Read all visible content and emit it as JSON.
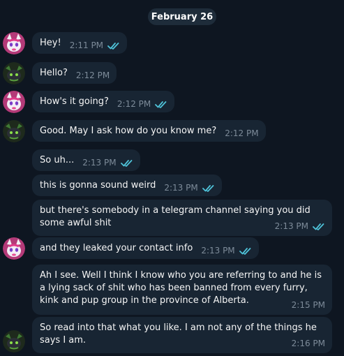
{
  "date": "February 26",
  "colors": {
    "background": "#0e1621",
    "bubble": "#182533",
    "check": "#4fc3d9",
    "time": "#7d8b99"
  },
  "avatars": {
    "user_a": "pink-furry-avatar",
    "user_b": "dark-dragon-avatar"
  },
  "messages": [
    {
      "text": "Hey!",
      "time": "2:11 PM",
      "read": true
    },
    {
      "text": "Hello?",
      "time": "2:12 PM",
      "read": false
    },
    {
      "text": "How's it going?",
      "time": "2:12 PM",
      "read": true
    },
    {
      "text": "Good. May I ask how do you know me?",
      "time": "2:12 PM",
      "read": false
    },
    {
      "text": "So uh...",
      "time": "2:13 PM",
      "read": true
    },
    {
      "text": "this is  gonna sound weird",
      "time": "2:13 PM",
      "read": true
    },
    {
      "text": "but there's somebody in a telegram channel saying you did some awful shit",
      "time": "2:13 PM",
      "read": true
    },
    {
      "text": "and they leaked your contact info",
      "time": "2:13 PM",
      "read": true
    },
    {
      "text": "Ah I see. Well I think I know who you are referring to and he is a lying sack of shit who has been banned from every furry, kink and pup group in the province of Alberta.",
      "time": "2:15 PM",
      "read": false
    },
    {
      "text": "So read into that what you like. I am not any of the things he says I am.",
      "time": "2:16 PM",
      "read": false
    }
  ]
}
